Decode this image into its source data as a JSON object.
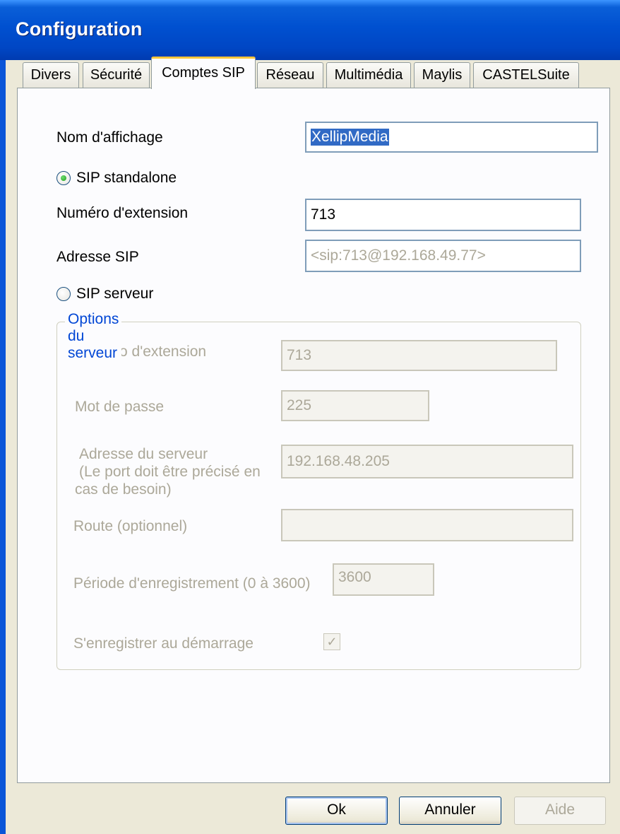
{
  "window": {
    "title": "Configuration"
  },
  "tabs": [
    {
      "label": "Divers"
    },
    {
      "label": "Sécurité"
    },
    {
      "label": "Comptes SIP",
      "active": true
    },
    {
      "label": "Réseau"
    },
    {
      "label": "Multimédia"
    },
    {
      "label": "Maylis"
    },
    {
      "label": "CASTELSuite"
    }
  ],
  "form": {
    "display_name_label": "Nom d'affichage",
    "display_name_value": "XellipMedia",
    "mode_standalone_label": "SIP standalone",
    "mode_standalone_selected": true,
    "extension_label": "Numéro d'extension",
    "extension_value": "713",
    "sip_address_label": "Adresse SIP",
    "sip_address_value": "<sip:713@192.168.49.77>",
    "mode_server_label": "SIP serveur",
    "mode_server_selected": false
  },
  "server_options": {
    "group_label": "Options du serveur",
    "extension_label": "Numéro d'extension",
    "extension_value": "713",
    "password_label": "Mot de passe",
    "password_value": "225",
    "address_label_line1": "Adresse du serveur",
    "address_label_line2": "(Le port doit être précisé en",
    "address_label_line3": "cas de besoin)",
    "address_value": "192.168.48.205",
    "route_label": "Route (optionnel)",
    "route_value": "",
    "registration_period_label": "Période d'enregistrement (0 à 3600)",
    "registration_period_value": "3600",
    "register_at_startup_label": "S'enregistrer au démarrage",
    "register_at_startup_checked": true
  },
  "buttons": {
    "ok": "Ok",
    "cancel": "Annuler",
    "help": "Aide"
  },
  "colors": {
    "titlebar": "#0050d0",
    "selection": "#316ac5",
    "group_label": "#0046d5",
    "active_tab_accent": "#ffc73c"
  }
}
